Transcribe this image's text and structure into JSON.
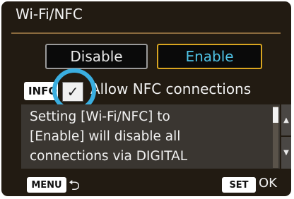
{
  "title": "Wi-Fi/NFC",
  "options": {
    "disable": "Disable",
    "enable": "Enable",
    "selected": "Enable"
  },
  "nfc": {
    "info_key": "INFO",
    "check_mark": "✓",
    "label": "Allow NFC connections",
    "checked": true
  },
  "description": [
    "Setting [Wi-Fi/NFC] to",
    "[Enable] will disable all",
    "connections via DIGITAL"
  ],
  "scroll": {
    "up_arrow": "▲",
    "down_arrow": "▼"
  },
  "footer": {
    "menu_key": "MENU",
    "back_icon": "⮌",
    "set_key": "SET",
    "ok": "OK"
  },
  "colors": {
    "accent_highlight": "#3aaee0",
    "selected_border": "#d9a520",
    "selected_text": "#4fc3e6"
  }
}
